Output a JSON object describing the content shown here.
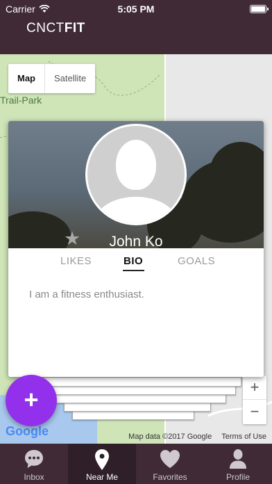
{
  "status_bar": {
    "carrier": "Carrier",
    "time": "5:05 PM"
  },
  "header": {
    "title_light": "CNCT",
    "title_bold": "FIT"
  },
  "map": {
    "toggle": {
      "map_label": "Map",
      "satellite_label": "Satellite",
      "selected": "Map"
    },
    "park_label": "Trail-Park",
    "zoom_in_label": "+",
    "zoom_out_label": "−",
    "google_logo": "Google",
    "attribution": "Map data ©2017 Google",
    "terms": "Terms of Use"
  },
  "profile_card": {
    "name": "John Ko",
    "tabs": [
      {
        "label": "LIKES",
        "active": false
      },
      {
        "label": "BIO",
        "active": true
      },
      {
        "label": "GOALS",
        "active": false
      }
    ],
    "bio": "I am a fitness enthusiast."
  },
  "fab": {
    "label": "+"
  },
  "tabbar": {
    "items": [
      {
        "label": "Inbox",
        "icon": "chat-bubble-icon",
        "active": false
      },
      {
        "label": "Near Me",
        "icon": "location-pin-icon",
        "active": true
      },
      {
        "label": "Favorites",
        "icon": "heart-icon",
        "active": false
      },
      {
        "label": "Profile",
        "icon": "person-icon",
        "active": false
      }
    ]
  },
  "colors": {
    "header_bg": "#3f2a36",
    "accent_purple": "#9230ec",
    "park_green": "#cfe5b8"
  }
}
